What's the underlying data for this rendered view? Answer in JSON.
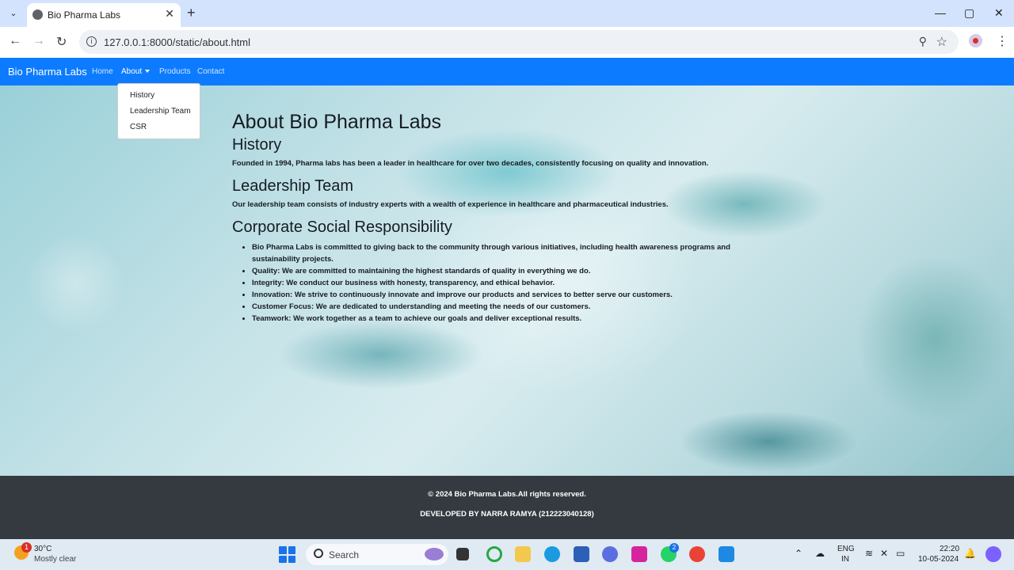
{
  "browser": {
    "tab_title": "Bio Pharma Labs",
    "url": "127.0.0.1:8000/static/about.html"
  },
  "navbar": {
    "brand": "Bio Pharma Labs",
    "links": [
      "Home",
      "About",
      "Products",
      "Contact"
    ],
    "dropdown_items": [
      "History",
      "Leadership Team",
      "CSR"
    ]
  },
  "content": {
    "title": "About Bio Pharma Labs",
    "history_heading": "History",
    "history_text": "Founded in 1994, Pharma labs has been a leader in healthcare for over two decades, consistently focusing on quality and innovation.",
    "leadership_heading": "Leadership Team",
    "leadership_text": "Our leadership team consists of industry experts with a wealth of experience in healthcare and pharmaceutical industries.",
    "csr_heading": "Corporate Social Responsibility",
    "csr_items": [
      "Bio Pharma Labs is committed to giving back to the community through various initiatives, including health awareness programs and sustainability projects.",
      "Quality: We are committed to maintaining the highest standards of quality in everything we do.",
      "Integrity: We conduct our business with honesty, transparency, and ethical behavior.",
      "Innovation: We strive to continuously innovate and improve our products and services to better serve our customers.",
      "Customer Focus: We are dedicated to understanding and meeting the needs of our customers.",
      "Teamwork: We work together as a team to achieve our goals and deliver exceptional results."
    ]
  },
  "footer": {
    "copyright": "© 2024 Bio Pharma Labs.All rights reserved.",
    "developer": "DEVELOPED BY NARRA RAMYA (212223040128)"
  },
  "taskbar": {
    "weather_temp": "30°C",
    "weather_desc": "Mostly clear",
    "weather_badge": "1",
    "search_placeholder": "Search",
    "whatsapp_badge": "2",
    "lang_top": "ENG",
    "lang_bottom": "IN",
    "time": "22:20",
    "date": "10-05-2024"
  },
  "colors": {
    "navbar": "#0d7bff",
    "footer": "#343a40"
  }
}
